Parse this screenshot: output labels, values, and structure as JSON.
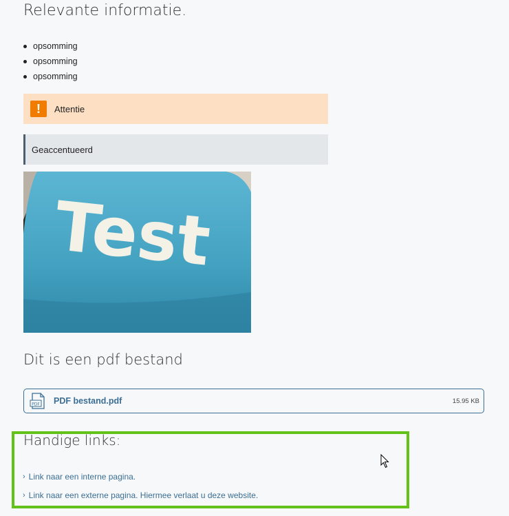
{
  "section": {
    "title": "Relevante informatie.",
    "bullets": [
      "opsomming",
      "opsomming",
      "opsomming"
    ]
  },
  "attention": {
    "text": "Attentie",
    "icon": "warning-icon",
    "color": "#f07c00",
    "background": "#fde0c4"
  },
  "accent": {
    "text": "Geaccentueerd",
    "background": "#e3e7ea",
    "border_color": "#4c5f70"
  },
  "image": {
    "text": "Test",
    "key_color": "#45a3c2"
  },
  "pdf_section": {
    "title": "Dit is een pdf bestand",
    "file": {
      "name": "PDF bestand.pdf",
      "size": "15.95 KB",
      "icon": "pdf-file-icon",
      "icon_label": "PDF"
    }
  },
  "links": {
    "title": "Handige links:",
    "items": [
      {
        "label": "Link naar een interne pagina."
      },
      {
        "label": "Link naar een externe pagina. Hiermee verlaat u deze website."
      }
    ],
    "chevron": "›",
    "highlight_color": "#62c21a",
    "link_color": "#3b6e95"
  }
}
